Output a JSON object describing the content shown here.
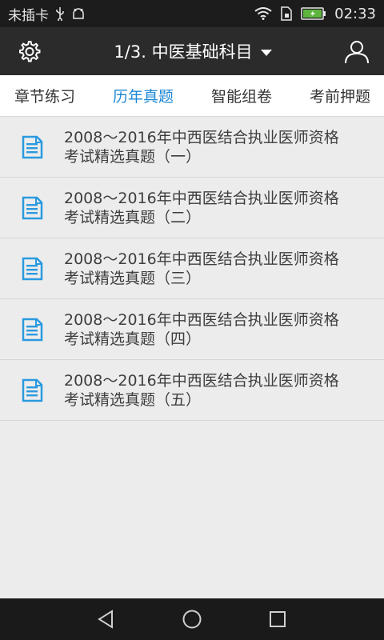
{
  "status_bar": {
    "carrier": "未插卡",
    "time": "02:33",
    "icons": [
      "usb-icon",
      "android-debug-icon",
      "wifi-icon",
      "sim-icon",
      "battery-charging-icon"
    ]
  },
  "header": {
    "title": "1/3. 中医基础科目",
    "left_icon": "gear-icon",
    "right_icon": "user-icon"
  },
  "tabs": [
    {
      "label": "章节练习",
      "active": false
    },
    {
      "label": "历年真题",
      "active": true
    },
    {
      "label": "智能组卷",
      "active": false
    },
    {
      "label": "考前押题",
      "active": false
    }
  ],
  "list": {
    "items": [
      {
        "line1": "2008～2016年中西医结合执业医师资格",
        "line2": "考试精选真题（一）"
      },
      {
        "line1": "2008～2016年中西医结合执业医师资格",
        "line2": "考试精选真题（二）"
      },
      {
        "line1": "2008～2016年中西医结合执业医师资格",
        "line2": "考试精选真题（三）"
      },
      {
        "line1": "2008～2016年中西医结合执业医师资格",
        "line2": "考试精选真题（四）"
      },
      {
        "line1": "2008～2016年中西医结合执业医师资格",
        "line2": "考试精选真题（五）"
      }
    ]
  },
  "nav_bar": {
    "icons": [
      "back-icon",
      "home-icon",
      "recents-icon"
    ]
  },
  "colors": {
    "accent": "#1e88d6",
    "doc_icon": "#2a9ae0",
    "header_bg": "#2b2b2b",
    "status_bg": "#1c1c1c"
  }
}
